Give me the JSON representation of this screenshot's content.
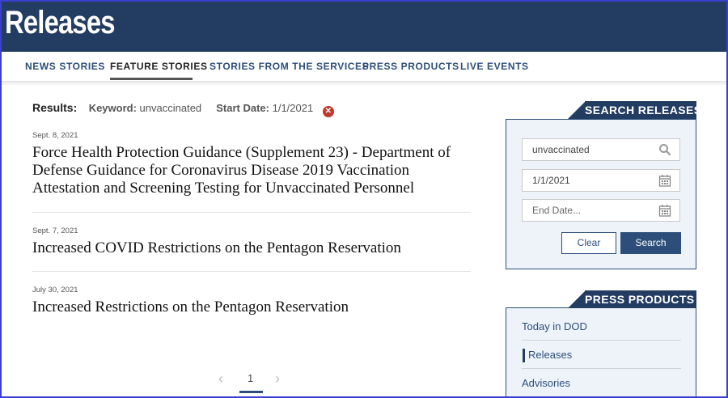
{
  "header": {
    "title": "Releases"
  },
  "nav": {
    "items": [
      {
        "label": "NEWS STORIES"
      },
      {
        "label": "FEATURE STORIES"
      },
      {
        "label": "STORIES FROM THE SERVICES"
      },
      {
        "label": "PRESS PRODUCTS"
      },
      {
        "label": "LIVE EVENTS"
      }
    ],
    "active": "FEATURE STORIES"
  },
  "results": {
    "label": "Results:",
    "keyword_label": "Keyword:",
    "keyword_value": "unvaccinated",
    "start_label": "Start Date:",
    "start_value": "1/1/2021",
    "clear_icon": "x-circle-icon"
  },
  "stories": [
    {
      "date": "Sept. 8, 2021",
      "title": "Force Health Protection Guidance (Supplement 23) - Department of Defense Guidance for Coronavirus Disease 2019 Vaccination Attestation and Screening Testing for Unvaccinated Personnel"
    },
    {
      "date": "Sept. 7, 2021",
      "title": "Increased COVID Restrictions on the Pentagon Reservation"
    },
    {
      "date": "July 30, 2021",
      "title": "Increased Restrictions on the Pentagon Reservation"
    }
  ],
  "pagination": {
    "current": "1",
    "prev_icon": "chevron-left-icon",
    "next_icon": "chevron-right-icon"
  },
  "search_panel": {
    "title": "SEARCH RELEASES",
    "keyword_value": "unvaccinated",
    "start_date_value": "1/1/2021",
    "end_date_placeholder": "End Date...",
    "clear_label": "Clear",
    "search_label": "Search"
  },
  "press_products": {
    "title": "PRESS PRODUCTS",
    "items": [
      {
        "label": "Today in DOD"
      },
      {
        "label": "Releases"
      },
      {
        "label": "Advisories"
      }
    ],
    "active": "Releases"
  },
  "colors": {
    "brand_navy": "#233c62",
    "link_blue": "#2d4e7a",
    "clear_red": "#c0392b"
  }
}
